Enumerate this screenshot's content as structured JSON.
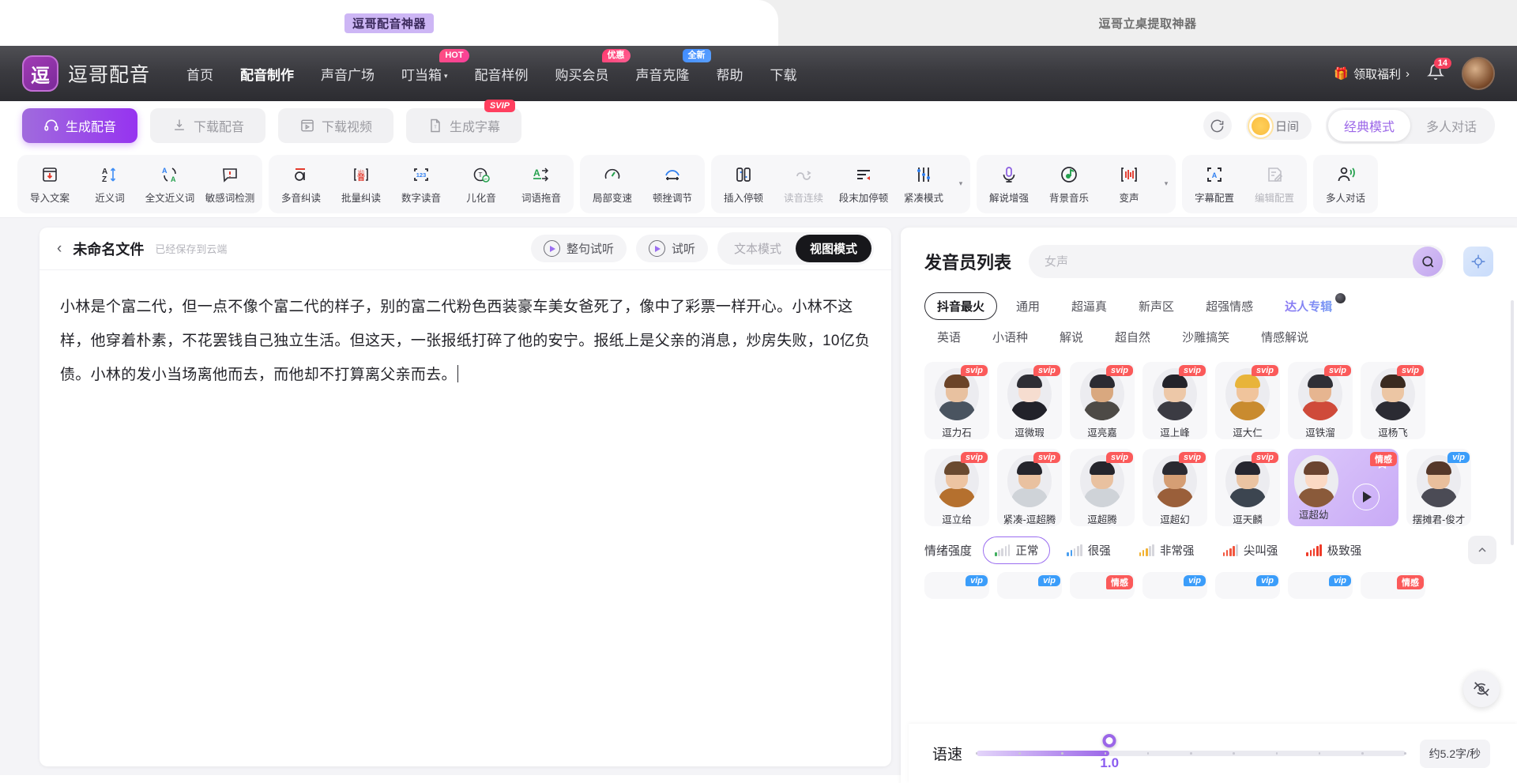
{
  "browser_tabs": {
    "active": "逗哥配音神器",
    "inactive": "逗哥立桌提取神器"
  },
  "nav": {
    "brand": "逗哥配音",
    "logo_glyph": "逗",
    "links": [
      {
        "label": "首页",
        "active": false,
        "badge": null,
        "caret": false
      },
      {
        "label": "配音制作",
        "active": true,
        "badge": null,
        "caret": false
      },
      {
        "label": "声音广场",
        "active": false,
        "badge": null,
        "caret": false
      },
      {
        "label": "叮当箱",
        "active": false,
        "badge": "HOT",
        "badge_kind": "hot",
        "caret": true
      },
      {
        "label": "配音样例",
        "active": false,
        "badge": null,
        "caret": false
      },
      {
        "label": "购买会员",
        "active": false,
        "badge": "优惠",
        "badge_kind": "promo",
        "caret": false
      },
      {
        "label": "声音克隆",
        "active": false,
        "badge": "全新",
        "badge_kind": "fresh",
        "caret": false
      },
      {
        "label": "帮助",
        "active": false,
        "badge": null,
        "caret": false
      },
      {
        "label": "下载",
        "active": false,
        "badge": null,
        "caret": false
      }
    ],
    "gift_label": "领取福利",
    "gift_chevron": "›",
    "notification_count": "14"
  },
  "actionbar": {
    "buttons": [
      {
        "label": "生成配音",
        "icon": "headphones-icon",
        "primary": true,
        "badge": null
      },
      {
        "label": "下载配音",
        "icon": "download-audio-icon",
        "primary": false,
        "badge": null
      },
      {
        "label": "下载视频",
        "icon": "download-video-icon",
        "primary": false,
        "badge": null
      },
      {
        "label": "生成字幕",
        "icon": "subtitle-file-icon",
        "primary": false,
        "badge": "SVIP"
      }
    ],
    "theme_label": "日间",
    "modes": [
      {
        "label": "经典模式",
        "on": true
      },
      {
        "label": "多人对话",
        "on": false
      }
    ]
  },
  "toolbar_groups": [
    {
      "tools": [
        {
          "label": "导入文案",
          "icon": "import-doc-icon",
          "dim": false
        },
        {
          "label": "近义词",
          "icon": "synonym-az-icon",
          "dim": false
        },
        {
          "label": "全文近义词",
          "icon": "full-text-synonym-icon",
          "dim": false
        },
        {
          "label": "敏感词检测",
          "icon": "sensitive-word-icon",
          "dim": false
        }
      ],
      "caret": false
    },
    {
      "tools": [
        {
          "label": "多音纠读",
          "icon": "polyphone-icon",
          "dim": false
        },
        {
          "label": "批量纠读",
          "icon": "batch-correct-icon",
          "dim": false
        },
        {
          "label": "数字读音",
          "icon": "number-read-icon",
          "dim": false
        },
        {
          "label": "儿化音",
          "icon": "erhua-icon",
          "dim": false
        },
        {
          "label": "词语拖音",
          "icon": "word-drag-icon",
          "dim": false
        }
      ],
      "caret": false
    },
    {
      "tools": [
        {
          "label": "局部变速",
          "icon": "speedometer-icon",
          "dim": false
        },
        {
          "label": "顿挫调节",
          "icon": "cadence-icon",
          "dim": false
        }
      ],
      "caret": false
    },
    {
      "tools": [
        {
          "label": "插入停顿",
          "icon": "insert-pause-icon",
          "dim": false
        },
        {
          "label": "读音连续",
          "icon": "continuous-read-icon",
          "dim": true
        },
        {
          "label": "段末加停顿",
          "icon": "paragraph-pause-icon",
          "dim": false
        },
        {
          "label": "紧凑模式",
          "icon": "compact-mode-icon",
          "dim": false
        }
      ],
      "caret": true
    },
    {
      "tools": [
        {
          "label": "解说增强",
          "icon": "microphone-icon",
          "dim": false
        },
        {
          "label": "背景音乐",
          "icon": "music-note-icon",
          "dim": false
        },
        {
          "label": "变声",
          "icon": "voice-change-icon",
          "dim": false
        }
      ],
      "caret": true
    },
    {
      "tools": [
        {
          "label": "字幕配置",
          "icon": "subtitle-config-icon",
          "dim": false
        },
        {
          "label": "编辑配置",
          "icon": "edit-config-icon",
          "dim": true
        }
      ],
      "caret": false
    },
    {
      "tools": [
        {
          "label": "多人对话",
          "icon": "multi-person-icon",
          "dim": false
        }
      ],
      "caret": false
    }
  ],
  "editor": {
    "title": "未命名文件",
    "saved_status": "已经保存到云端",
    "listen_sentence": "整句试听",
    "listen": "试听",
    "view_modes": [
      {
        "label": "文本模式",
        "on": false
      },
      {
        "label": "视图模式",
        "on": true
      }
    ],
    "content": "小林是个富二代，但一点不像个富二代的样子，别的富二代粉色西装豪车美女爸死了，像中了彩票一样开心。小林不这样，他穿着朴素，不花罢钱自己独立生活。但这天，一张报纸打碎了他的安宁。报纸上是父亲的消息，炒房失败，10亿负债。小林的发小当场离他而去，而他却不打算离父亲而去。"
  },
  "voice_panel": {
    "title": "发音员列表",
    "search_placeholder": "女声",
    "search_value": "",
    "tags_row1": [
      {
        "label": "抖音最火",
        "selected": true,
        "special": false
      },
      {
        "label": "通用",
        "selected": false,
        "special": false
      },
      {
        "label": "超逼真",
        "selected": false,
        "special": false
      },
      {
        "label": "新声区",
        "selected": false,
        "special": false
      },
      {
        "label": "超强情感",
        "selected": false,
        "special": false
      },
      {
        "label": "达人专辑",
        "selected": false,
        "special": true
      }
    ],
    "tags_row2": [
      {
        "label": "英语",
        "selected": false,
        "special": false
      },
      {
        "label": "小语种",
        "selected": false,
        "special": false
      },
      {
        "label": "解说",
        "selected": false,
        "special": false
      },
      {
        "label": "超自然",
        "selected": false,
        "special": false
      },
      {
        "label": "沙雕搞笑",
        "selected": false,
        "special": false
      },
      {
        "label": "情感解说",
        "selected": false,
        "special": false
      }
    ],
    "voices_row1": [
      {
        "name": "逗力石",
        "tag": "svip",
        "selected": false,
        "hair": "#6b4428",
        "skin": "#e8c1a0",
        "body": "#4a5460"
      },
      {
        "name": "逗微瑕",
        "tag": "svip",
        "selected": false,
        "hair": "#2e2e35",
        "skin": "#f6ddd0",
        "body": "#22222a"
      },
      {
        "name": "逗亮嘉",
        "tag": "svip",
        "selected": false,
        "hair": "#2b2b32",
        "skin": "#d9a87f",
        "body": "#4d4a46"
      },
      {
        "name": "逗上峰",
        "tag": "svip",
        "selected": false,
        "hair": "#23232a",
        "skin": "#edc8a8",
        "body": "#3b3b43"
      },
      {
        "name": "逗大仁",
        "tag": "svip",
        "selected": false,
        "hair": "#e8b43a",
        "skin": "#f0c49c",
        "body": "#c98b2f"
      },
      {
        "name": "逗铁溜",
        "tag": "svip",
        "selected": false,
        "hair": "#2f2f36",
        "skin": "#e6b590",
        "body": "#cf4a3a"
      },
      {
        "name": "逗杨飞",
        "tag": "svip",
        "selected": false,
        "hair": "#3a2a20",
        "skin": "#ecc6a4",
        "body": "#2b2b33"
      }
    ],
    "voices_row2": [
      {
        "name": "逗立给",
        "tag": "svip",
        "selected": false,
        "hair": "#6a4a30",
        "skin": "#edc4a2",
        "body": "#b5702e"
      },
      {
        "name": "紧凑-逗超腾",
        "tag": "svip",
        "selected": false,
        "hair": "#25252c",
        "skin": "#e9c1a0",
        "body": "#cfd3d8"
      },
      {
        "name": "逗超腾",
        "tag": "svip",
        "selected": false,
        "hair": "#25252c",
        "skin": "#e9c1a0",
        "body": "#cfd3d8"
      },
      {
        "name": "逗超幻",
        "tag": "svip",
        "selected": false,
        "hair": "#2a2a31",
        "skin": "#d59e74",
        "body": "#9a5f3a"
      },
      {
        "name": "逗天麟",
        "tag": "svip",
        "selected": false,
        "hair": "#262630",
        "skin": "#eac3a2",
        "body": "#3c4550"
      },
      {
        "name": "逗超幼",
        "tag": "emo",
        "tag_label": "情感",
        "selected": true,
        "hair": "#6b4430",
        "skin": "#fbd9c4",
        "body": "#8a5a3a"
      },
      {
        "name": "摆摊君-俊才",
        "tag": "vip",
        "selected": false,
        "hair": "#55382a",
        "skin": "#e9bf9c",
        "body": "#4b4b55"
      }
    ],
    "partial_voices": [
      {
        "tag": "vip"
      },
      {
        "tag": "vip"
      },
      {
        "tag": "emo",
        "tag_label": "情感"
      },
      {
        "tag": "vip"
      },
      {
        "tag": "vip"
      },
      {
        "tag": "vip"
      },
      {
        "tag": "emo",
        "tag_label": "情感"
      }
    ],
    "emotion": {
      "label": "情绪强度",
      "options": [
        {
          "label": "正常",
          "on": true,
          "color": "#3fae5e",
          "bars": 1
        },
        {
          "label": "很强",
          "on": false,
          "color": "#4a9ff0",
          "bars": 2
        },
        {
          "label": "非常强",
          "on": false,
          "color": "#f2b233",
          "bars": 3
        },
        {
          "label": "尖叫强",
          "on": false,
          "color": "#f2553d",
          "bars": 4
        },
        {
          "label": "极致强",
          "on": false,
          "color": "#ef3b28",
          "bars": 5
        }
      ]
    }
  },
  "speed": {
    "label": "语速",
    "value": "1.0",
    "rate_text": "约5.2字/秒",
    "fill_percent": 31
  },
  "colors": {
    "primary": "#9633f0",
    "accent": "#9b66e8",
    "svip": "#fb5a5a",
    "vip": "#3b9dfa",
    "nav_bg": "#3b3b40"
  }
}
